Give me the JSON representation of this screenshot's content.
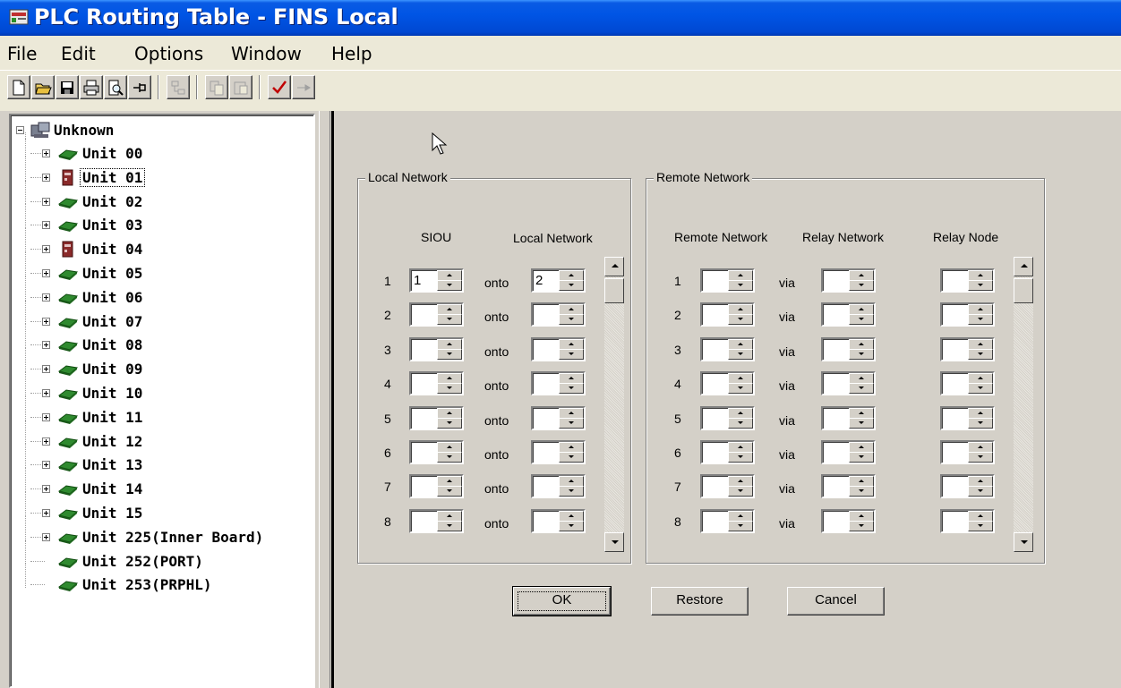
{
  "window": {
    "title": "PLC Routing Table - FINS Local"
  },
  "menu": [
    "File",
    "Edit",
    "Options",
    "Window",
    "Help"
  ],
  "toolbar": {
    "buttons": [
      {
        "icon": "new-file-icon",
        "enabled": true
      },
      {
        "icon": "open-folder-icon",
        "enabled": true
      },
      {
        "icon": "save-icon",
        "enabled": true
      },
      {
        "icon": "print-icon",
        "enabled": true
      },
      {
        "icon": "print-preview-icon",
        "enabled": true
      },
      {
        "icon": "pin-icon",
        "enabled": true
      },
      {
        "icon": "network-icon",
        "enabled": false
      },
      {
        "icon": "copy-icon",
        "enabled": false
      },
      {
        "icon": "paste-icon",
        "enabled": false
      },
      {
        "icon": "checkmark-icon",
        "enabled": true
      },
      {
        "icon": "transfer-icon",
        "enabled": false
      }
    ]
  },
  "tree": {
    "root": "Unknown",
    "items": [
      {
        "label": "Unit 00",
        "icon": "green-board-icon",
        "expandable": true
      },
      {
        "label": "Unit 01",
        "icon": "red-device-icon",
        "expandable": true,
        "selected": true
      },
      {
        "label": "Unit 02",
        "icon": "green-board-icon",
        "expandable": true
      },
      {
        "label": "Unit 03",
        "icon": "green-board-icon",
        "expandable": true
      },
      {
        "label": "Unit 04",
        "icon": "red-device-icon",
        "expandable": true
      },
      {
        "label": "Unit 05",
        "icon": "green-board-icon",
        "expandable": true
      },
      {
        "label": "Unit 06",
        "icon": "green-board-icon",
        "expandable": true
      },
      {
        "label": "Unit 07",
        "icon": "green-board-icon",
        "expandable": true
      },
      {
        "label": "Unit 08",
        "icon": "green-board-icon",
        "expandable": true
      },
      {
        "label": "Unit 09",
        "icon": "green-board-icon",
        "expandable": true
      },
      {
        "label": "Unit 10",
        "icon": "green-board-icon",
        "expandable": true
      },
      {
        "label": "Unit 11",
        "icon": "green-board-icon",
        "expandable": true
      },
      {
        "label": "Unit 12",
        "icon": "green-board-icon",
        "expandable": true
      },
      {
        "label": "Unit 13",
        "icon": "green-board-icon",
        "expandable": true
      },
      {
        "label": "Unit 14",
        "icon": "green-board-icon",
        "expandable": true
      },
      {
        "label": "Unit 15",
        "icon": "green-board-icon",
        "expandable": true
      },
      {
        "label": "Unit 225(Inner Board)",
        "icon": "green-board-icon",
        "expandable": true
      },
      {
        "label": "Unit 252(PORT)",
        "icon": "green-board-icon",
        "expandable": false
      },
      {
        "label": "Unit 253(PRPHL)",
        "icon": "green-board-icon",
        "expandable": false
      }
    ]
  },
  "local_network": {
    "title": "Local Network",
    "col_siou": "SIOU",
    "col_local_network": "Local Network",
    "connector": "onto",
    "rows": [
      {
        "num": "1",
        "siou": "1",
        "local": "2"
      },
      {
        "num": "2",
        "siou": "",
        "local": ""
      },
      {
        "num": "3",
        "siou": "",
        "local": ""
      },
      {
        "num": "4",
        "siou": "",
        "local": ""
      },
      {
        "num": "5",
        "siou": "",
        "local": ""
      },
      {
        "num": "6",
        "siou": "",
        "local": ""
      },
      {
        "num": "7",
        "siou": "",
        "local": ""
      },
      {
        "num": "8",
        "siou": "",
        "local": ""
      }
    ]
  },
  "remote_network": {
    "title": "Remote Network",
    "col_remote": "Remote Network",
    "col_relay_network": "Relay Network",
    "col_relay_node": "Relay Node",
    "connector": "via",
    "rows": [
      {
        "num": "1",
        "remote": "",
        "relay_net": "",
        "relay_node": ""
      },
      {
        "num": "2",
        "remote": "",
        "relay_net": "",
        "relay_node": ""
      },
      {
        "num": "3",
        "remote": "",
        "relay_net": "",
        "relay_node": ""
      },
      {
        "num": "4",
        "remote": "",
        "relay_net": "",
        "relay_node": ""
      },
      {
        "num": "5",
        "remote": "",
        "relay_net": "",
        "relay_node": ""
      },
      {
        "num": "6",
        "remote": "",
        "relay_net": "",
        "relay_node": ""
      },
      {
        "num": "7",
        "remote": "",
        "relay_net": "",
        "relay_node": ""
      },
      {
        "num": "8",
        "remote": "",
        "relay_net": "",
        "relay_node": ""
      }
    ]
  },
  "buttons": {
    "ok": "OK",
    "restore": "Restore",
    "cancel": "Cancel"
  },
  "colors": {
    "titlebar": "#0055e5",
    "face": "#d4d0c8",
    "menu": "#ece9d8"
  }
}
